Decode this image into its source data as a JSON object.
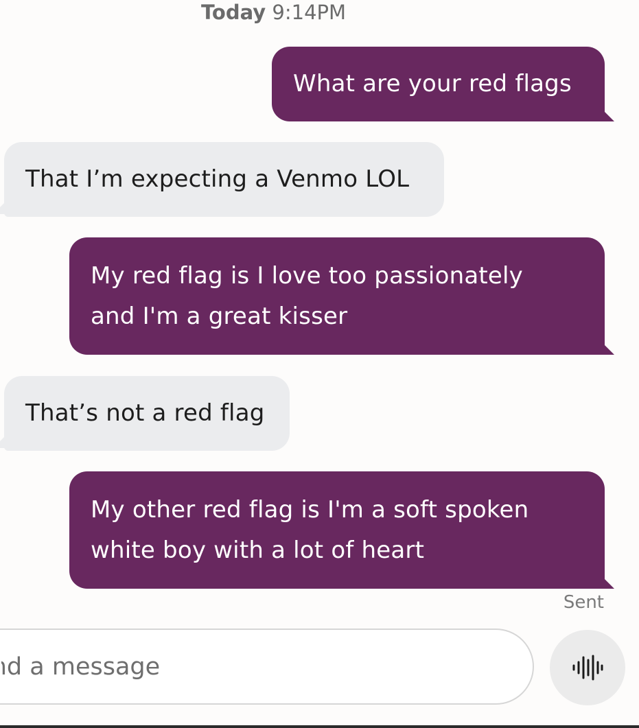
{
  "header": {
    "day": "Today",
    "time": "9:14PM"
  },
  "messages": [
    {
      "direction": "outgoing",
      "lines": [
        "What are your red flags"
      ]
    },
    {
      "direction": "incoming",
      "lines": [
        "That I’m expecting a Venmo LOL"
      ]
    },
    {
      "direction": "outgoing",
      "lines": [
        "My red flag is I love too passionately",
        "and I'm a great kisser"
      ]
    },
    {
      "direction": "incoming",
      "lines": [
        "That’s not a red flag"
      ]
    },
    {
      "direction": "outgoing",
      "lines": [
        "My other red flag is I'm a soft spoken",
        "white boy with a lot of heart"
      ]
    }
  ],
  "status": {
    "sent_label": "Sent"
  },
  "composer": {
    "placeholder": "Send a message",
    "voice_icon": "voice-waveform-icon"
  },
  "colors": {
    "outgoing_bubble": "#68285f",
    "incoming_bubble": "#ebecee",
    "background": "#fdfcfb"
  }
}
